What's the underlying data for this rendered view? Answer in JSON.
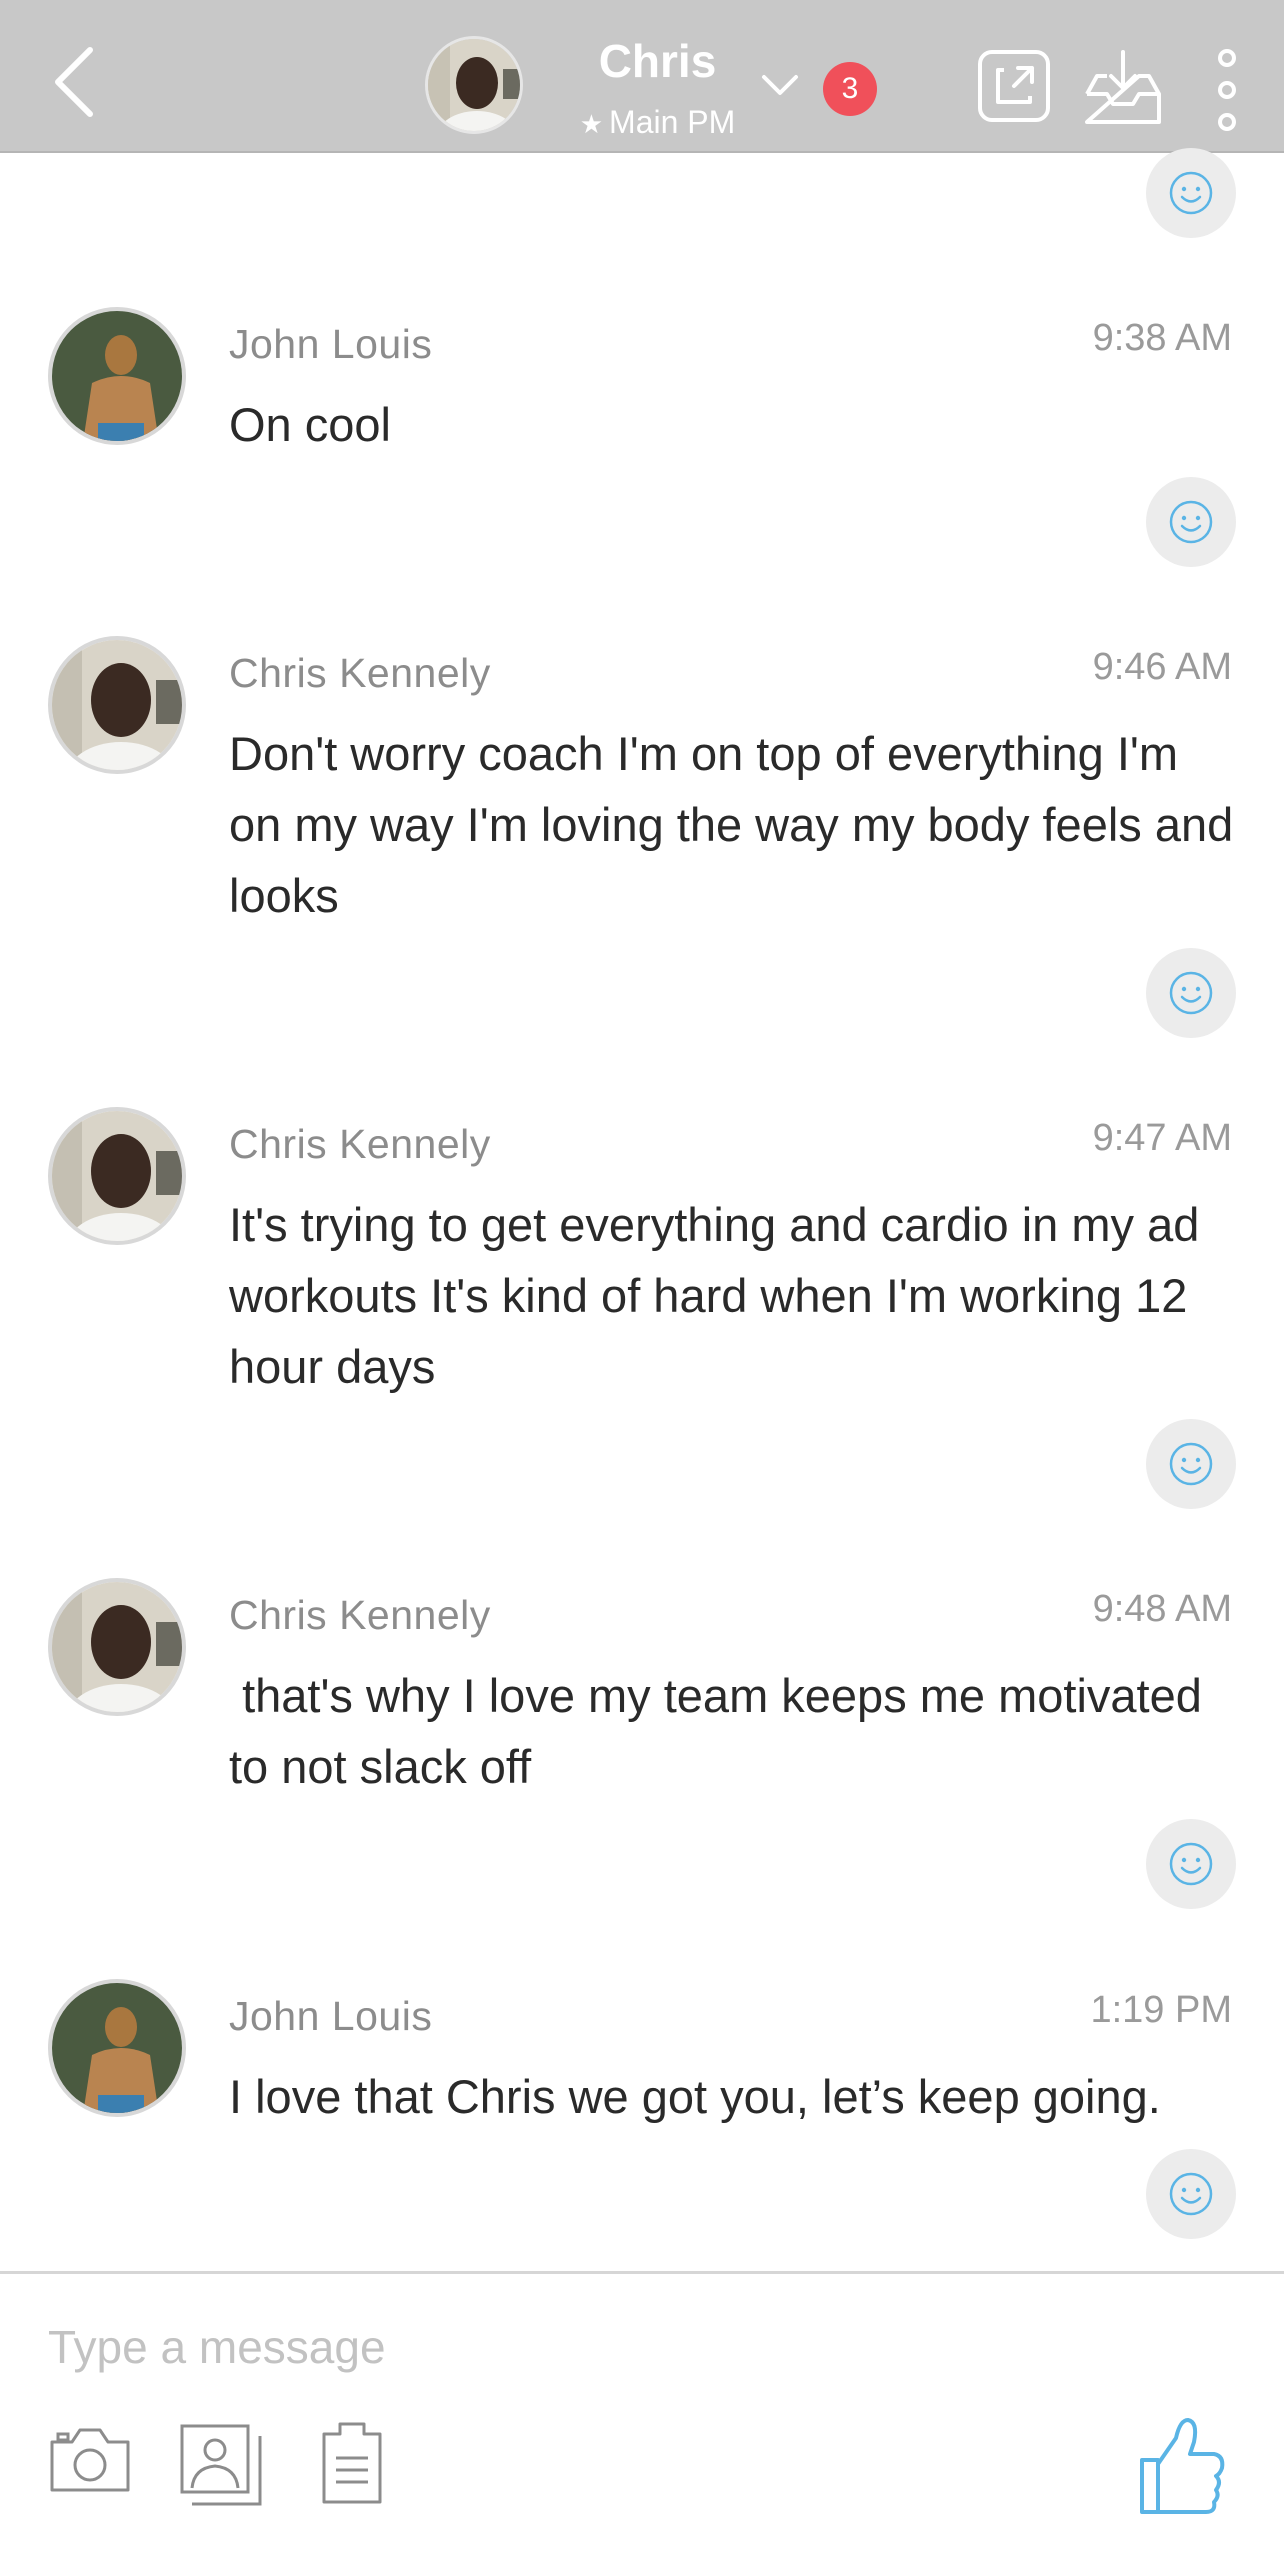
{
  "header": {
    "title": "Chris",
    "subtitle": "Main PM",
    "badge_count": "3",
    "icons": [
      "back-arrow-icon",
      "avatar",
      "chevron-down-icon",
      "external-link-icon",
      "inbox-download-icon",
      "more-vertical-icon"
    ]
  },
  "messages": [
    {
      "sender": "John Louis",
      "time": "9:38 AM",
      "text": "On cool",
      "avatar": "john-louis"
    },
    {
      "sender": "Chris Kennely",
      "time": "9:46 AM",
      "text": "Don't worry coach I'm on top of everything I'm on my way I'm loving the way my body feels and looks",
      "avatar": "chris-kennely"
    },
    {
      "sender": "Chris Kennely",
      "time": "9:47 AM",
      "text": "It's trying to get everything and cardio in my ad workouts It's kind of hard when I'm working 12 hour days",
      "avatar": "chris-kennely"
    },
    {
      "sender": "Chris Kennely",
      "time": "9:48 AM",
      "text": " that's why I love my team keeps me motivated to not slack off",
      "avatar": "chris-kennely"
    },
    {
      "sender": "John Louis",
      "time": "1:19 PM",
      "text": "I love that Chris we got you, let’s keep going.",
      "avatar": "john-louis"
    }
  ],
  "composer": {
    "placeholder": "Type a message",
    "icons": [
      "camera-icon",
      "photo-library-icon",
      "document-icon",
      "thumbs-up-icon"
    ]
  },
  "colors": {
    "header_bg": "#c8c8c8",
    "badge": "#f0505a",
    "accent_blue": "#5ab4e5",
    "timestamp": "#9a9a9a"
  }
}
